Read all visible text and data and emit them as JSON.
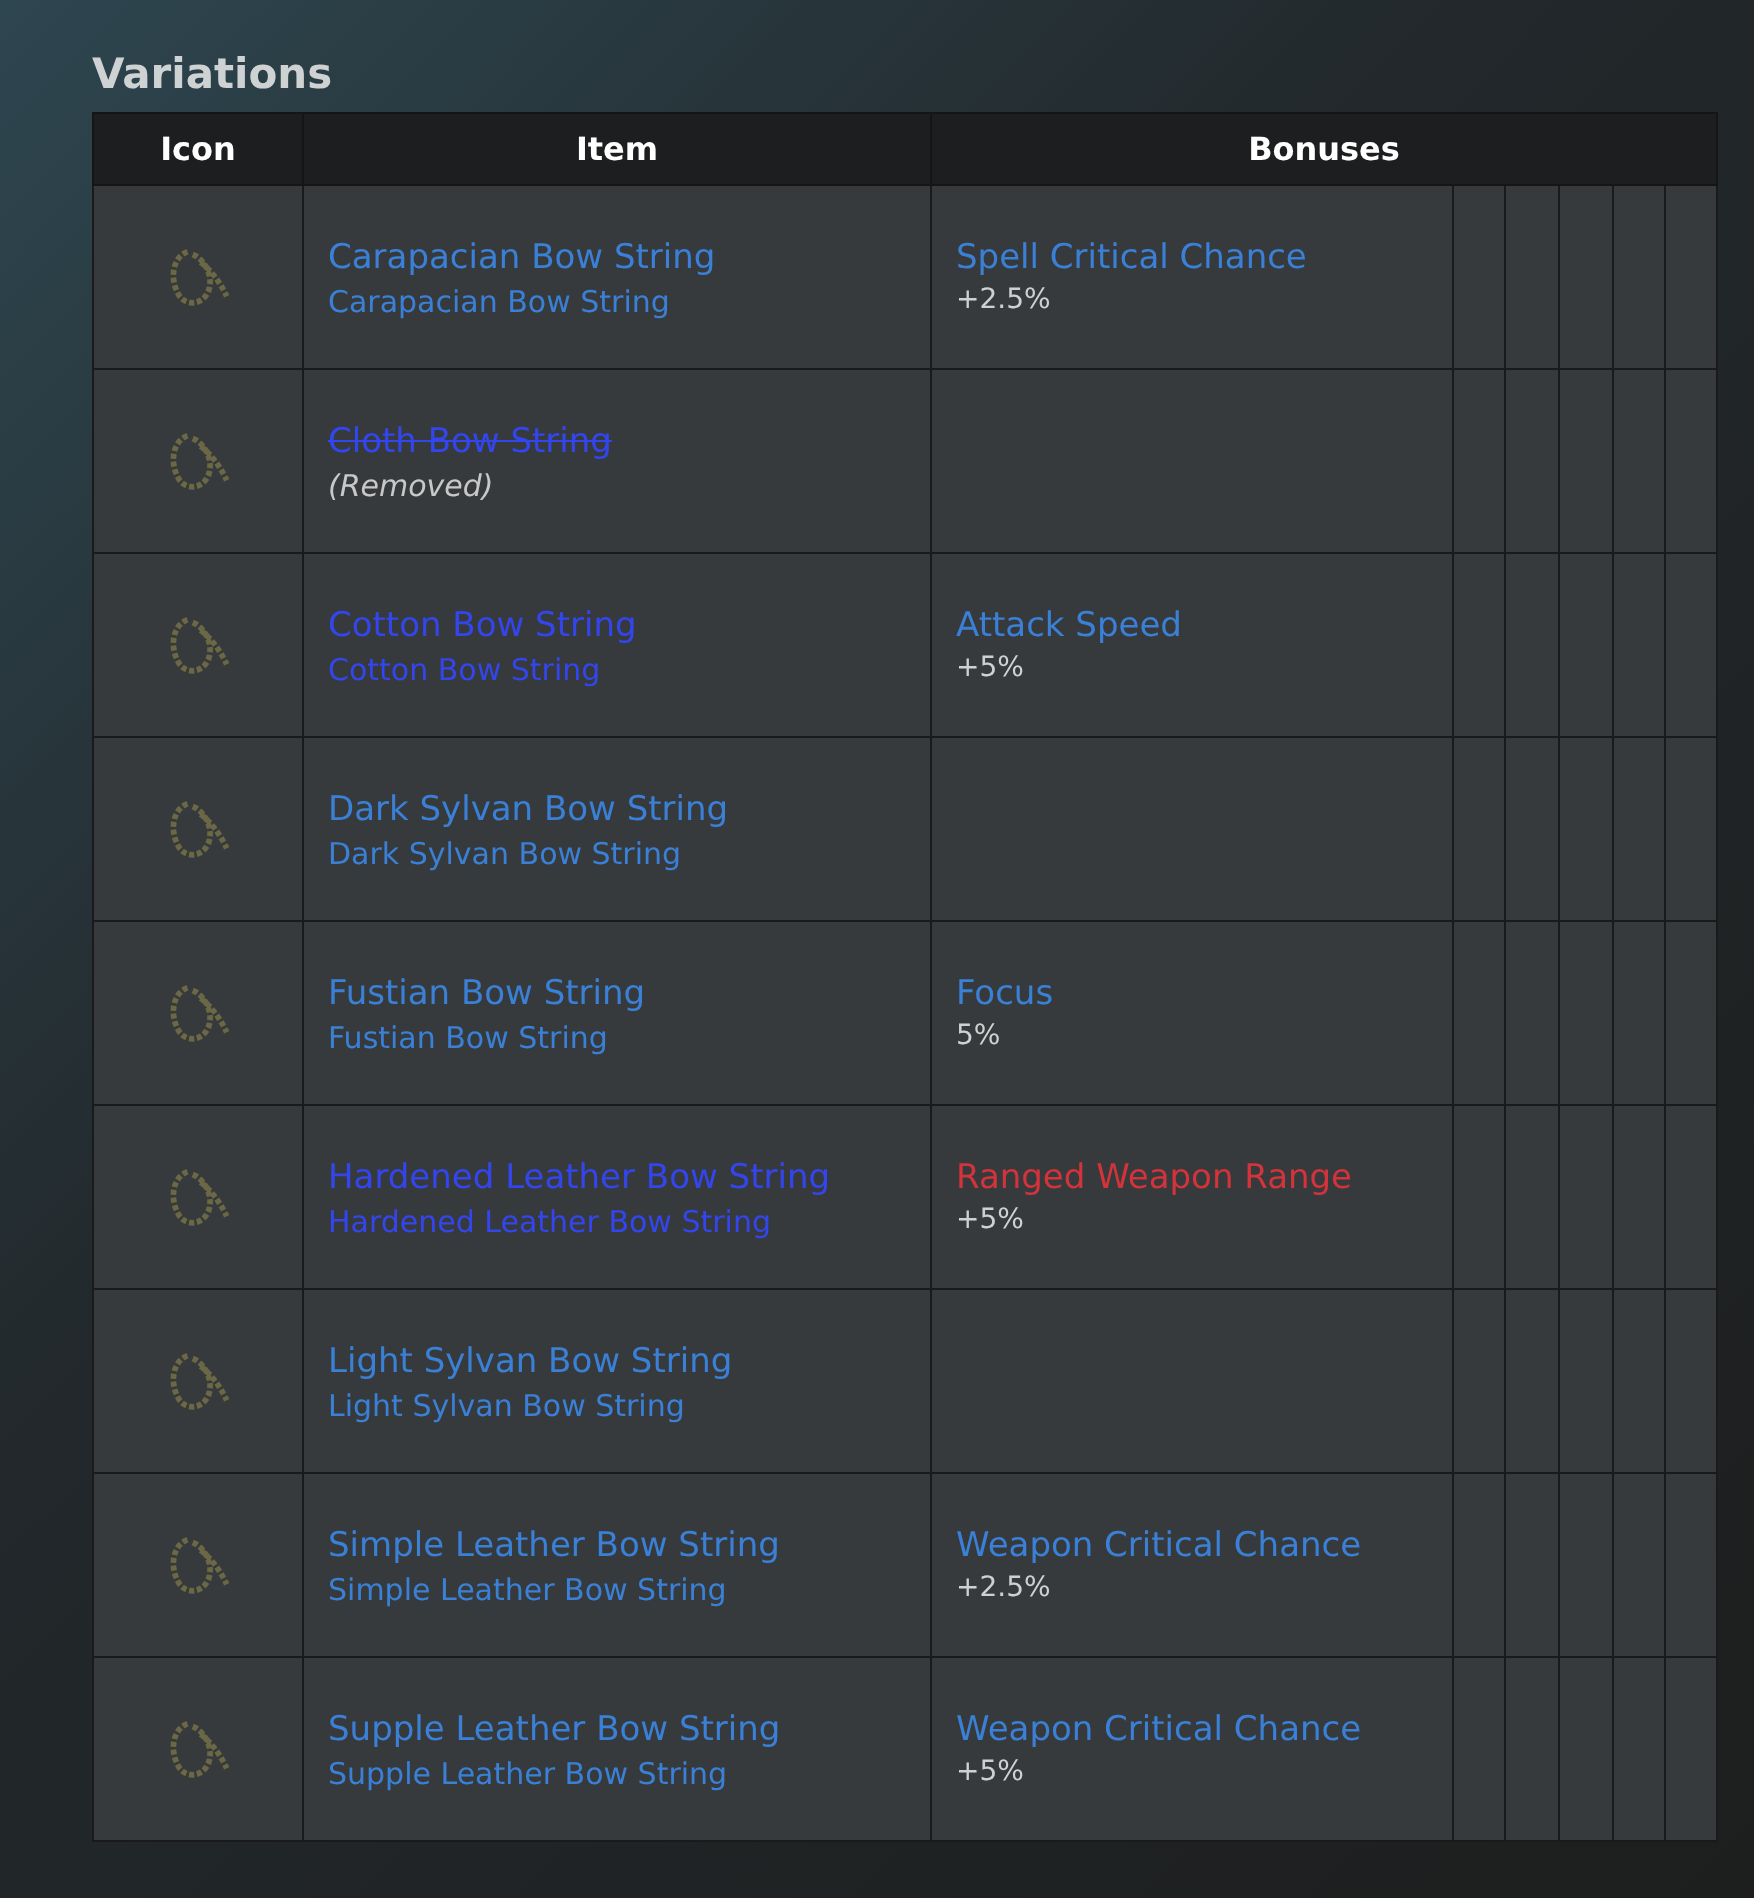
{
  "section_title": "Variations",
  "columns": [
    "Icon",
    "Item",
    "Bonuses"
  ],
  "rows": [
    {
      "item": "Carapacian Bow String",
      "subtitle": "Carapacian Bow String",
      "color": "#3a80d6",
      "removed": false,
      "bonus": {
        "name": "Spell Critical Chance",
        "color": "#3a80d6",
        "value": "+2.5%"
      }
    },
    {
      "item": "Cloth Bow String",
      "subtitle": "(Removed)",
      "color": "#3346ee",
      "removed": true
    },
    {
      "item": "Cotton Bow String",
      "subtitle": "Cotton Bow String",
      "color": "#3346ee",
      "removed": false,
      "bonus": {
        "name": "Attack Speed",
        "color": "#3a80d6",
        "value": "+5%"
      }
    },
    {
      "item": "Dark Sylvan Bow String",
      "subtitle": "Dark Sylvan Bow String",
      "color": "#3a80d6",
      "removed": false
    },
    {
      "item": "Fustian Bow String",
      "subtitle": "Fustian Bow String",
      "color": "#3a80d6",
      "removed": false,
      "bonus": {
        "name": "Focus",
        "color": "#3a80d6",
        "value": "5%"
      }
    },
    {
      "item": "Hardened Leather Bow String",
      "subtitle": "Hardened Leather Bow String",
      "color": "#3346ee",
      "removed": false,
      "bonus": {
        "name": "Ranged Weapon Range",
        "color": "#d3333a",
        "value": "+5%"
      }
    },
    {
      "item": "Light Sylvan Bow String",
      "subtitle": "Light Sylvan Bow String",
      "color": "#3a80d6",
      "removed": false
    },
    {
      "item": "Simple Leather Bow String",
      "subtitle": "Simple Leather Bow String",
      "color": "#3a80d6",
      "removed": false,
      "bonus": {
        "name": "Weapon Critical Chance",
        "color": "#3a80d6",
        "value": "+2.5%"
      }
    },
    {
      "item": "Supple Leather Bow String",
      "subtitle": "Supple Leather Bow String",
      "color": "#3a80d6",
      "removed": false,
      "bonus": {
        "name": "Weapon Critical Chance",
        "color": "#3a80d6",
        "value": "+5%"
      }
    }
  ]
}
